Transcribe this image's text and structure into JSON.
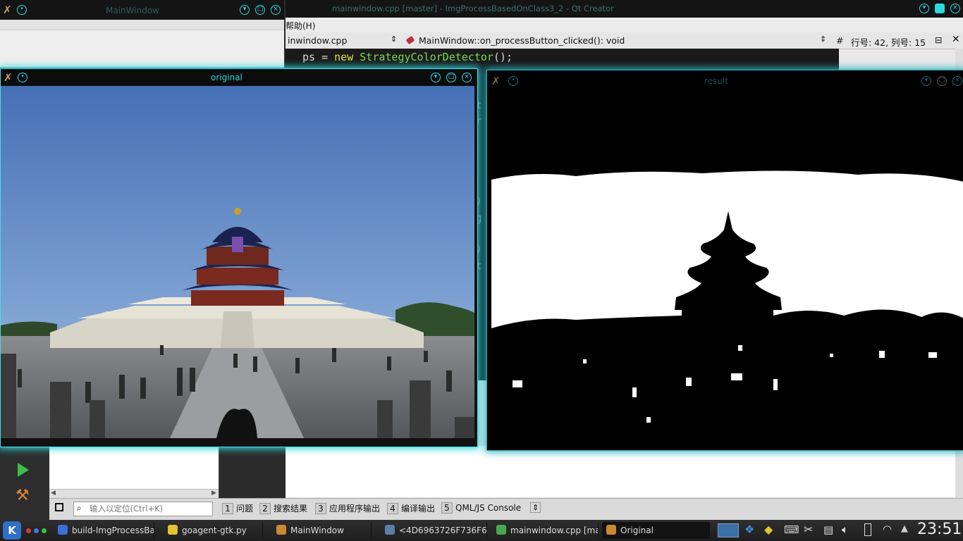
{
  "qt_creator": {
    "window_title": "mainwindow.cpp [master] - ImgProcessBasedOnClass3_2 - Qt Creator",
    "menu_help": "帮助(H)",
    "file_combo": "inwindow.cpp",
    "function_combo": "MainWindow::on_processButton_clicked(): void",
    "hash": "#",
    "cursor_position": "行号: 42, 列号: 15",
    "code_line": {
      "indent": "ps = ",
      "keyword": "new",
      "class_name": "StrategyColorDetector",
      "rest": "();"
    },
    "gutter_chars": [
      "t",
      "r",
      ")",
      "g",
      ")",
      "t"
    ],
    "status_tabs": [
      {
        "num": "1",
        "label": "问题"
      },
      {
        "num": "2",
        "label": "搜索结果"
      },
      {
        "num": "3",
        "label": "应用程序输出"
      },
      {
        "num": "4",
        "label": "编译输出"
      },
      {
        "num": "5",
        "label": "QML/JS Console"
      }
    ],
    "locator_placeholder": "输入以定位(Ctrl+K)"
  },
  "main_window": {
    "title": "MainWindow"
  },
  "original_window": {
    "title": "original"
  },
  "result_window": {
    "title": "result"
  },
  "taskbar": {
    "tasks": [
      {
        "label": "build-ImgProcessBas",
        "icon_color": "#3b6fd6"
      },
      {
        "label": "goagent-gtk.py",
        "icon_color": "#e4c232"
      },
      {
        "label": "MainWindow",
        "icon_color": "#cc8833"
      },
      {
        "label": "<4D6963726F736F66",
        "icon_color": "#5a7fa8"
      },
      {
        "label": "mainwindow.cpp [ma",
        "icon_color": "#49a84b"
      },
      {
        "label": "Original",
        "icon_color": "#cc8833"
      }
    ],
    "clock": "23:51"
  },
  "colors": {
    "accent": "#2fd7e0",
    "sky": "#4a78bf",
    "ground": "#6f7176"
  }
}
